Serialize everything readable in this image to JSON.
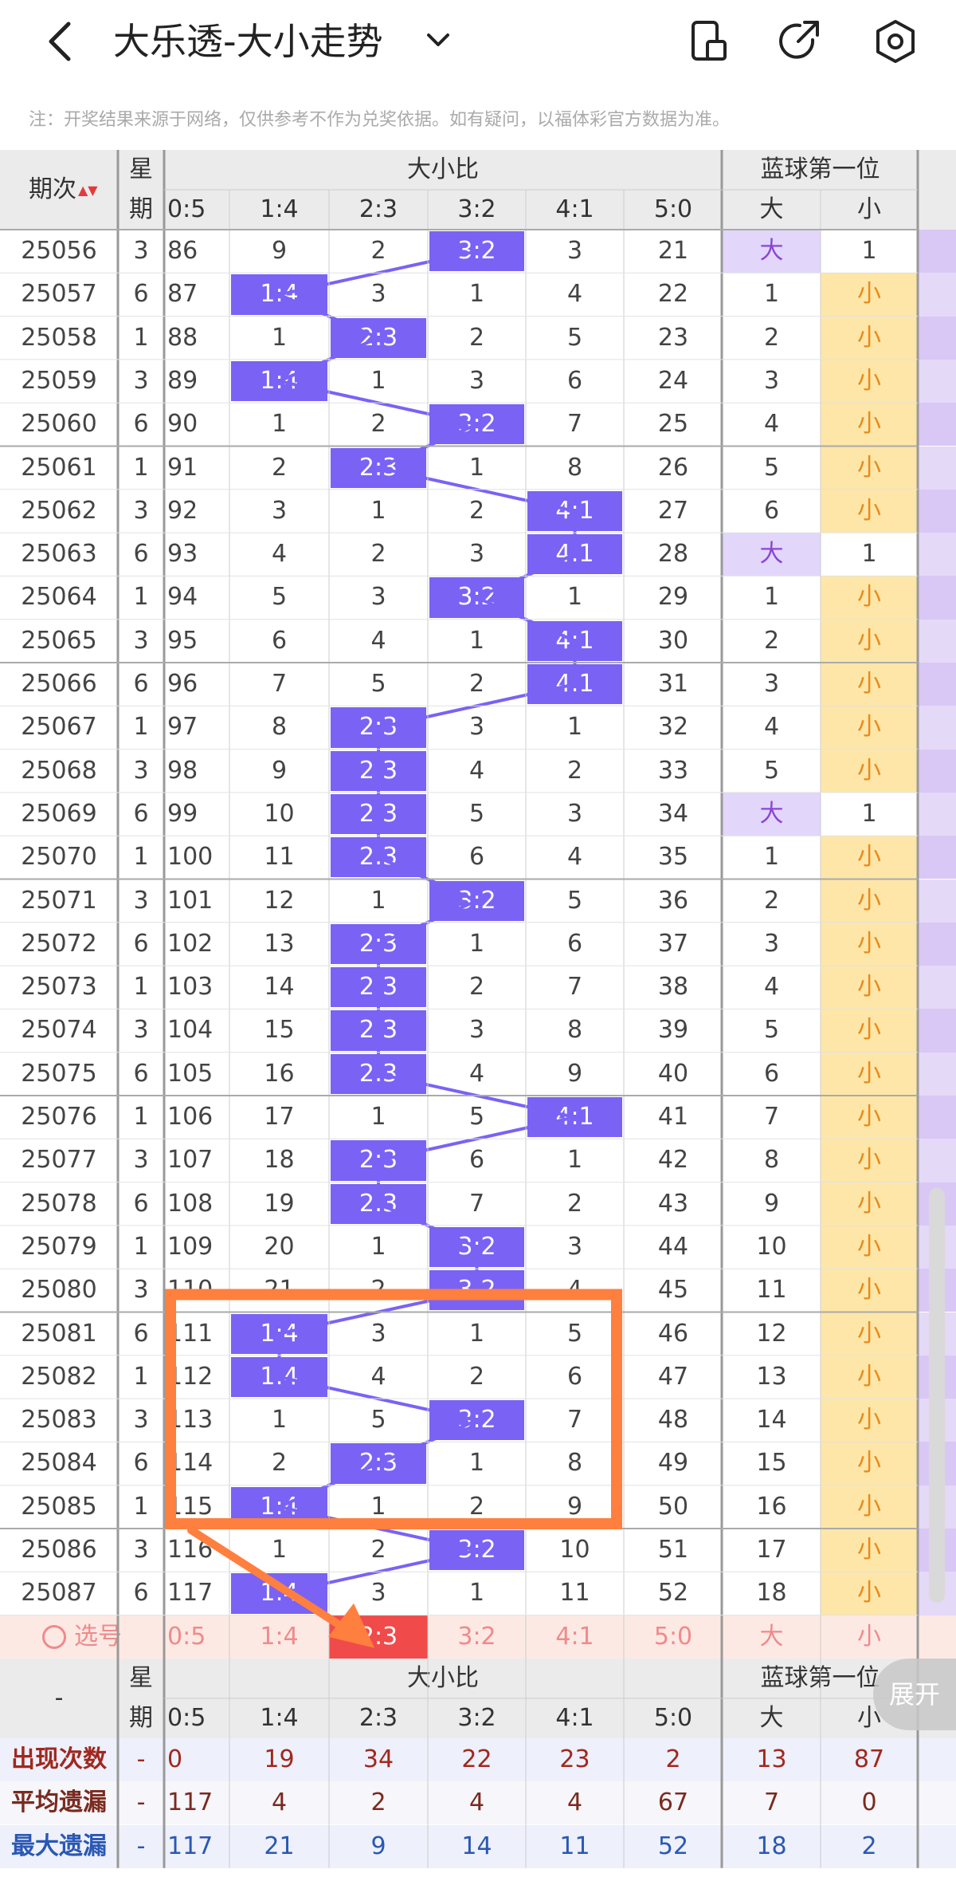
{
  "header": {
    "title": "大乐透-大小走势",
    "back_icon": "chevron-left-icon",
    "dropdown_icon": "chevron-down-icon",
    "icons": [
      "phone-icon",
      "share-icon",
      "settings-icon"
    ]
  },
  "notice": "注：开奖结果来源于网络，仅供参考不作为兑奖依据。如有疑问，以福体彩官方数据为准。",
  "columns": {
    "issue": "期次",
    "week": "星期",
    "group1": "大小比",
    "group2": "蓝球第一位",
    "ratios": [
      "0:5",
      "1:4",
      "2:3",
      "3:2",
      "4:1",
      "5:0"
    ],
    "blue": [
      "大",
      "小"
    ]
  },
  "sort_arrows": "▲▼",
  "rows": [
    {
      "issue": "25056",
      "week": "3",
      "c": [
        "86",
        "9",
        "2",
        "3:2",
        "3",
        "21"
      ],
      "b": [
        "大",
        "1"
      ]
    },
    {
      "issue": "25057",
      "week": "6",
      "c": [
        "87",
        "1:4",
        "3",
        "1",
        "4",
        "22"
      ],
      "b": [
        "1",
        "小"
      ]
    },
    {
      "issue": "25058",
      "week": "1",
      "c": [
        "88",
        "1",
        "2:3",
        "2",
        "5",
        "23"
      ],
      "b": [
        "2",
        "小"
      ]
    },
    {
      "issue": "25059",
      "week": "3",
      "c": [
        "89",
        "1:4",
        "1",
        "3",
        "6",
        "24"
      ],
      "b": [
        "3",
        "小"
      ]
    },
    {
      "issue": "25060",
      "week": "6",
      "c": [
        "90",
        "1",
        "2",
        "3:2",
        "7",
        "25"
      ],
      "b": [
        "4",
        "小"
      ]
    },
    {
      "issue": "25061",
      "week": "1",
      "c": [
        "91",
        "2",
        "2:3",
        "1",
        "8",
        "26"
      ],
      "b": [
        "5",
        "小"
      ]
    },
    {
      "issue": "25062",
      "week": "3",
      "c": [
        "92",
        "3",
        "1",
        "2",
        "4:1",
        "27"
      ],
      "b": [
        "6",
        "小"
      ]
    },
    {
      "issue": "25063",
      "week": "6",
      "c": [
        "93",
        "4",
        "2",
        "3",
        "4:1",
        "28"
      ],
      "b": [
        "大",
        "1"
      ]
    },
    {
      "issue": "25064",
      "week": "1",
      "c": [
        "94",
        "5",
        "3",
        "3:2",
        "1",
        "29"
      ],
      "b": [
        "1",
        "小"
      ]
    },
    {
      "issue": "25065",
      "week": "3",
      "c": [
        "95",
        "6",
        "4",
        "1",
        "4:1",
        "30"
      ],
      "b": [
        "2",
        "小"
      ]
    },
    {
      "issue": "25066",
      "week": "6",
      "c": [
        "96",
        "7",
        "5",
        "2",
        "4:1",
        "31"
      ],
      "b": [
        "3",
        "小"
      ]
    },
    {
      "issue": "25067",
      "week": "1",
      "c": [
        "97",
        "8",
        "2:3",
        "3",
        "1",
        "32"
      ],
      "b": [
        "4",
        "小"
      ]
    },
    {
      "issue": "25068",
      "week": "3",
      "c": [
        "98",
        "9",
        "2:3",
        "4",
        "2",
        "33"
      ],
      "b": [
        "5",
        "小"
      ]
    },
    {
      "issue": "25069",
      "week": "6",
      "c": [
        "99",
        "10",
        "2:3",
        "5",
        "3",
        "34"
      ],
      "b": [
        "大",
        "1"
      ]
    },
    {
      "issue": "25070",
      "week": "1",
      "c": [
        "100",
        "11",
        "2:3",
        "6",
        "4",
        "35"
      ],
      "b": [
        "1",
        "小"
      ]
    },
    {
      "issue": "25071",
      "week": "3",
      "c": [
        "101",
        "12",
        "1",
        "3:2",
        "5",
        "36"
      ],
      "b": [
        "2",
        "小"
      ]
    },
    {
      "issue": "25072",
      "week": "6",
      "c": [
        "102",
        "13",
        "2:3",
        "1",
        "6",
        "37"
      ],
      "b": [
        "3",
        "小"
      ]
    },
    {
      "issue": "25073",
      "week": "1",
      "c": [
        "103",
        "14",
        "2:3",
        "2",
        "7",
        "38"
      ],
      "b": [
        "4",
        "小"
      ]
    },
    {
      "issue": "25074",
      "week": "3",
      "c": [
        "104",
        "15",
        "2:3",
        "3",
        "8",
        "39"
      ],
      "b": [
        "5",
        "小"
      ]
    },
    {
      "issue": "25075",
      "week": "6",
      "c": [
        "105",
        "16",
        "2:3",
        "4",
        "9",
        "40"
      ],
      "b": [
        "6",
        "小"
      ]
    },
    {
      "issue": "25076",
      "week": "1",
      "c": [
        "106",
        "17",
        "1",
        "5",
        "4:1",
        "41"
      ],
      "b": [
        "7",
        "小"
      ]
    },
    {
      "issue": "25077",
      "week": "3",
      "c": [
        "107",
        "18",
        "2:3",
        "6",
        "1",
        "42"
      ],
      "b": [
        "8",
        "小"
      ]
    },
    {
      "issue": "25078",
      "week": "6",
      "c": [
        "108",
        "19",
        "2:3",
        "7",
        "2",
        "43"
      ],
      "b": [
        "9",
        "小"
      ]
    },
    {
      "issue": "25079",
      "week": "1",
      "c": [
        "109",
        "20",
        "1",
        "3:2",
        "3",
        "44"
      ],
      "b": [
        "10",
        "小"
      ]
    },
    {
      "issue": "25080",
      "week": "3",
      "c": [
        "110",
        "21",
        "2",
        "3:2",
        "4",
        "45"
      ],
      "b": [
        "11",
        "小"
      ]
    },
    {
      "issue": "25081",
      "week": "6",
      "c": [
        "111",
        "1:4",
        "3",
        "1",
        "5",
        "46"
      ],
      "b": [
        "12",
        "小"
      ]
    },
    {
      "issue": "25082",
      "week": "1",
      "c": [
        "112",
        "1:4",
        "4",
        "2",
        "6",
        "47"
      ],
      "b": [
        "13",
        "小"
      ]
    },
    {
      "issue": "25083",
      "week": "3",
      "c": [
        "113",
        "1",
        "5",
        "3:2",
        "7",
        "48"
      ],
      "b": [
        "14",
        "小"
      ]
    },
    {
      "issue": "25084",
      "week": "6",
      "c": [
        "114",
        "2",
        "2:3",
        "1",
        "8",
        "49"
      ],
      "b": [
        "15",
        "小"
      ]
    },
    {
      "issue": "25085",
      "week": "1",
      "c": [
        "115",
        "1:4",
        "1",
        "2",
        "9",
        "50"
      ],
      "b": [
        "16",
        "小"
      ]
    },
    {
      "issue": "25086",
      "week": "3",
      "c": [
        "116",
        "1",
        "2",
        "3:2",
        "10",
        "51"
      ],
      "b": [
        "17",
        "小"
      ]
    },
    {
      "issue": "25087",
      "week": "6",
      "c": [
        "117",
        "1:4",
        "3",
        "1",
        "11",
        "52"
      ],
      "b": [
        "18",
        "小"
      ]
    }
  ],
  "select_row": {
    "label": "选号",
    "ratios": [
      "0:5",
      "1:4",
      "2:3",
      "3:2",
      "4:1",
      "5:0"
    ],
    "blue": [
      "大",
      "小"
    ],
    "selected_index": 2
  },
  "footer_header": {
    "dash": "-",
    "week": "星期",
    "group1": "大小比",
    "group2": "蓝球第一位",
    "ratios": [
      "0:5",
      "1:4",
      "2:3",
      "3:2",
      "4:1",
      "5:0"
    ],
    "blue": [
      "大",
      "小"
    ]
  },
  "stats": [
    {
      "label": "出现次数",
      "week": "-",
      "values": [
        "0",
        "19",
        "34",
        "22",
        "23",
        "2",
        "13",
        "87"
      ],
      "color": "#a0281e"
    },
    {
      "label": "平均遗漏",
      "week": "-",
      "values": [
        "117",
        "4",
        "2",
        "4",
        "4",
        "67",
        "7",
        "0"
      ],
      "color": "#7a2a1e"
    },
    {
      "label": "最大遗漏",
      "week": "-",
      "values": [
        "117",
        "21",
        "9",
        "14",
        "11",
        "52",
        "18",
        "2"
      ],
      "color": "#2a58b4"
    }
  ],
  "expand_button": "展开",
  "colors": {
    "highlight": "#7a62f5",
    "big_bg": "#e2d6fb",
    "small_bg": "#fde6a8",
    "annotation": "#ff7f3f",
    "selected": "#f04a4a"
  }
}
